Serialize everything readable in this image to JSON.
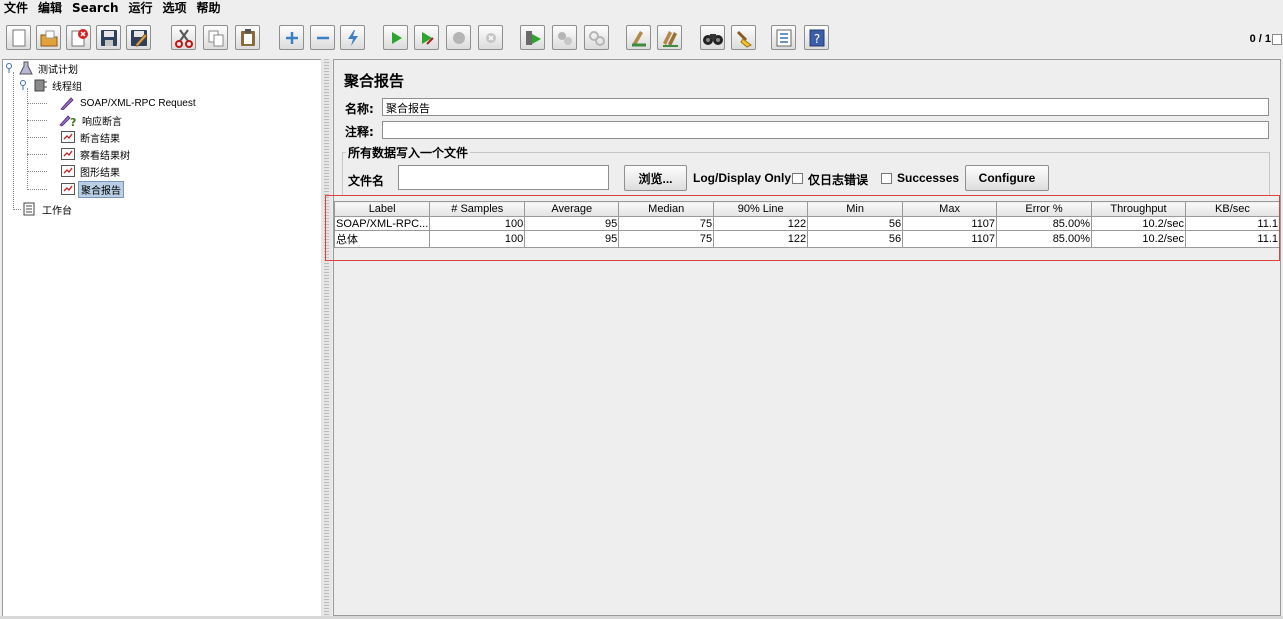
{
  "menu": [
    "文件",
    "编辑",
    "Search",
    "运行",
    "选项",
    "帮助"
  ],
  "toolbar": {
    "buttons": [
      {
        "name": "new-icon"
      },
      {
        "name": "open-icon"
      },
      {
        "name": "close-icon"
      },
      {
        "name": "save-icon"
      },
      {
        "name": "save-as-icon"
      },
      {
        "name": "cut-icon"
      },
      {
        "name": "copy-icon"
      },
      {
        "name": "paste-icon"
      },
      {
        "name": "expand-icon"
      },
      {
        "name": "collapse-icon"
      },
      {
        "name": "toggle-icon"
      },
      {
        "name": "start-icon"
      },
      {
        "name": "start-no-pause-icon"
      },
      {
        "name": "stop-icon"
      },
      {
        "name": "shutdown-icon"
      },
      {
        "name": "remote-start-icon"
      },
      {
        "name": "remote-stop-icon"
      },
      {
        "name": "remote-shutdown-icon"
      },
      {
        "name": "clear-icon"
      },
      {
        "name": "clear-all-icon"
      },
      {
        "name": "search-icon"
      },
      {
        "name": "reset-search-icon"
      },
      {
        "name": "function-helper-icon"
      },
      {
        "name": "help-icon"
      }
    ],
    "counter": "0 / 1"
  },
  "tree": {
    "test_plan": "测试计划",
    "thread_group": "线程组",
    "items": [
      "SOAP/XML-RPC Request",
      "响应断言",
      "断言结果",
      "察看结果树",
      "图形结果",
      "聚合报告"
    ],
    "workbench": "工作台"
  },
  "panel": {
    "title": "聚合报告",
    "name_label": "名称:",
    "name_value": "聚合报告",
    "comment_label": "注释:",
    "comment_value": "",
    "file_group_title": "所有数据写入一个文件",
    "filename_label": "文件名",
    "filename_value": "",
    "browse_label": "浏览...",
    "log_display_label": "Log/Display Only:",
    "errors_label": "仅日志错误",
    "successes_label": "Successes",
    "configure_label": "Configure"
  },
  "table": {
    "columns": [
      "Label",
      "# Samples",
      "Average",
      "Median",
      "90% Line",
      "Min",
      "Max",
      "Error %",
      "Throughput",
      "KB/sec"
    ],
    "rows": [
      [
        "SOAP/XML-RPC...",
        "100",
        "95",
        "75",
        "122",
        "56",
        "1107",
        "85.00%",
        "10.2/sec",
        "11.1"
      ],
      [
        "总体",
        "100",
        "95",
        "75",
        "122",
        "56",
        "1107",
        "85.00%",
        "10.2/sec",
        "11.1"
      ]
    ]
  }
}
